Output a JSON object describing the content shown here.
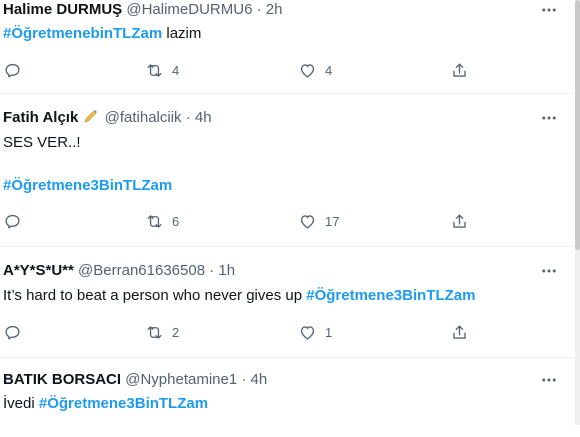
{
  "tweets": [
    {
      "name": "Halime DURMUŞ",
      "handle": "@HalimeDURMU6",
      "dot": "·",
      "time": "2h",
      "hashtag": "#ÖğretmenebinTLZam",
      "text_after": " lazim",
      "reply_count": "",
      "retweet_count": "4",
      "like_count": "4"
    },
    {
      "name": "Fatih Alçık",
      "emoji_icon": "writing-hand-icon",
      "handle": "@fatihalciik",
      "dot": "·",
      "time": "4h",
      "line1": "SES VER..!",
      "hashtag": "#Öğretmene3BinTLZam",
      "reply_count": "",
      "retweet_count": "6",
      "like_count": "17"
    },
    {
      "name": "A*Y*S*U**",
      "handle": "@Berran61636508",
      "dot": "·",
      "time": "1h",
      "text_before": "It’s hard to beat a person who never gives up ",
      "hashtag": "#Öğretmene3BinTLZam",
      "reply_count": "",
      "retweet_count": "2",
      "like_count": "1"
    },
    {
      "name": "BATIK BORSACI",
      "handle": "@Nyphetamine1",
      "dot": "·",
      "time": "4h",
      "text_before": "İvedi ",
      "hashtag": "#Öğretmene3BinTLZam"
    }
  ],
  "colors": {
    "accent": "#1d9bf0",
    "secondary_text": "#536471",
    "primary_text": "#0f1419",
    "divider": "#eff3f4"
  }
}
